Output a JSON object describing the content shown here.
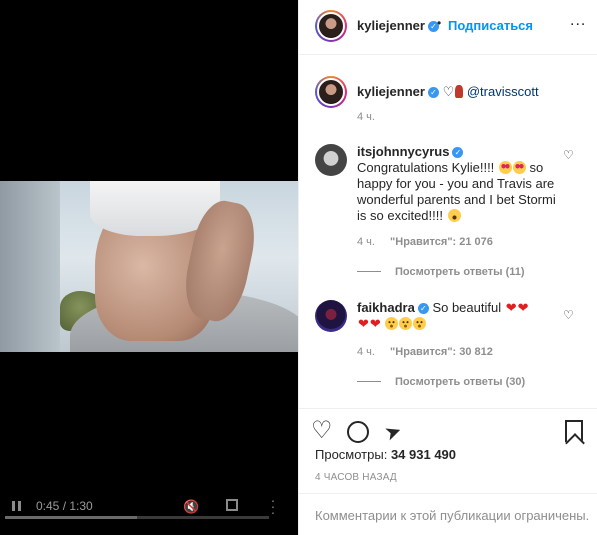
{
  "video": {
    "time": "0:45 / 1:30",
    "progress": 0.5,
    "mute_icon": "mute-icon",
    "fullscreen_icon": "fullscreen-icon",
    "more_icon": "more-vertical-icon"
  },
  "header": {
    "username": "kyliejenner",
    "separator": "•",
    "follow_label": "Подписаться",
    "more": "..."
  },
  "caption": {
    "username": "kyliejenner",
    "mention": "@travisscott",
    "time": "4 ч."
  },
  "comments": [
    {
      "username": "itsjohnnycyrus",
      "text_before": "Congratulations Kylie!!!!",
      "text_mid": "so happy for you - you and Travis are wonderful parents and I bet Stormi is so excited!!!!",
      "time": "4 ч.",
      "likes": "\"Нравится\": 21 076",
      "replies": "Посмотреть ответы (11)"
    },
    {
      "username": "faikhadra",
      "text": "So beautiful",
      "time": "4 ч.",
      "likes": "\"Нравится\": 30 812",
      "replies": "Посмотреть ответы (30)"
    }
  ],
  "stats": {
    "views_label": "Просмотры:",
    "views_value": "34 931 490",
    "posted": "4 ЧАСОВ НАЗАД"
  },
  "footer": {
    "text": "Комментарии к этой публикации ограничены."
  },
  "colors": {
    "accent": "#0095f6",
    "verified": "#3897f0",
    "muted": "#8e8e8e"
  }
}
